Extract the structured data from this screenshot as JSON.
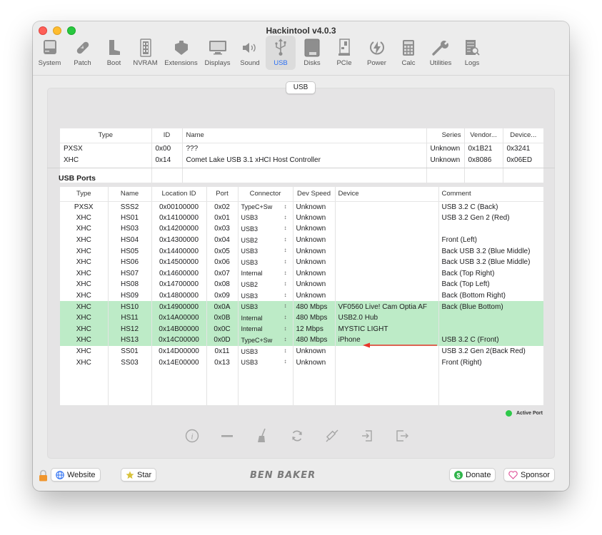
{
  "window": {
    "title": "Hackintool v4.0.3"
  },
  "toolbar": {
    "items": [
      {
        "label": "System",
        "icon": "system-icon"
      },
      {
        "label": "Patch",
        "icon": "bandage-icon"
      },
      {
        "label": "Boot",
        "icon": "boot-icon"
      },
      {
        "label": "NVRAM",
        "icon": "nvram-icon"
      },
      {
        "label": "Extensions",
        "icon": "extensions-icon"
      },
      {
        "label": "Displays",
        "icon": "display-icon"
      },
      {
        "label": "Sound",
        "icon": "speaker-icon"
      },
      {
        "label": "USB",
        "icon": "usb-icon",
        "active": true
      },
      {
        "label": "Disks",
        "icon": "disk-icon"
      },
      {
        "label": "PCIe",
        "icon": "pcie-icon"
      },
      {
        "label": "Power",
        "icon": "power-icon"
      },
      {
        "label": "Calc",
        "icon": "calculator-icon"
      },
      {
        "label": "Utilities",
        "icon": "wrench-icon"
      },
      {
        "label": "Logs",
        "icon": "logs-icon"
      }
    ]
  },
  "segment": {
    "label": "USB"
  },
  "controllers": {
    "headers": [
      "Type",
      "ID",
      "Name",
      "Series",
      "Vendor...",
      "Device..."
    ],
    "rows": [
      [
        "PXSX",
        "0x00",
        "???",
        "Unknown",
        "0x1B21",
        "0x3241"
      ],
      [
        "XHC",
        "0x14",
        "Comet Lake USB 3.1 xHCI Host Controller",
        "Unknown",
        "0x8086",
        "0x06ED"
      ]
    ]
  },
  "ports": {
    "section_label": "USB Ports",
    "headers": [
      "Type",
      "Name",
      "Location ID",
      "Port",
      "Connector",
      "Dev Speed",
      "Device",
      "Comment"
    ],
    "rows": [
      {
        "type": "PXSX",
        "name": "SSS2",
        "location": "0x00100000",
        "port": "0x02",
        "connector": "TypeC+Sw",
        "speed": "Unknown",
        "device": "",
        "comment": "USB 3.2 C (Back)",
        "active": false
      },
      {
        "type": "XHC",
        "name": "HS01",
        "location": "0x14100000",
        "port": "0x01",
        "connector": "USB3",
        "speed": "Unknown",
        "device": "",
        "comment": "USB 3.2 Gen 2 (Red)",
        "active": false
      },
      {
        "type": "XHC",
        "name": "HS03",
        "location": "0x14200000",
        "port": "0x03",
        "connector": "USB3",
        "speed": "Unknown",
        "device": "",
        "comment": "",
        "active": false
      },
      {
        "type": "XHC",
        "name": "HS04",
        "location": "0x14300000",
        "port": "0x04",
        "connector": "USB2",
        "speed": "Unknown",
        "device": "",
        "comment": "Front (Left)",
        "active": false
      },
      {
        "type": "XHC",
        "name": "HS05",
        "location": "0x14400000",
        "port": "0x05",
        "connector": "USB3",
        "speed": "Unknown",
        "device": "",
        "comment": "Back USB 3.2 (Blue Middle)",
        "active": false
      },
      {
        "type": "XHC",
        "name": "HS06",
        "location": "0x14500000",
        "port": "0x06",
        "connector": "USB3",
        "speed": "Unknown",
        "device": "",
        "comment": "Back USB 3.2 (Blue Middle)",
        "active": false
      },
      {
        "type": "XHC",
        "name": "HS07",
        "location": "0x14600000",
        "port": "0x07",
        "connector": "Internal",
        "speed": "Unknown",
        "device": "",
        "comment": "Back (Top Right)",
        "active": false
      },
      {
        "type": "XHC",
        "name": "HS08",
        "location": "0x14700000",
        "port": "0x08",
        "connector": "USB2",
        "speed": "Unknown",
        "device": "",
        "comment": "Back (Top Left)",
        "active": false
      },
      {
        "type": "XHC",
        "name": "HS09",
        "location": "0x14800000",
        "port": "0x09",
        "connector": "USB3",
        "speed": "Unknown",
        "device": "",
        "comment": "Back (Bottom Right)",
        "active": false
      },
      {
        "type": "XHC",
        "name": "HS10",
        "location": "0x14900000",
        "port": "0x0A",
        "connector": "USB3",
        "speed": "480 Mbps",
        "device": "VF0560 Live! Cam Optia AF",
        "comment": "Back (Blue Bottom)",
        "active": true
      },
      {
        "type": "XHC",
        "name": "HS11",
        "location": "0x14A00000",
        "port": "0x0B",
        "connector": "Internal",
        "speed": "480 Mbps",
        "device": "USB2.0 Hub",
        "comment": "",
        "active": true
      },
      {
        "type": "XHC",
        "name": "HS12",
        "location": "0x14B00000",
        "port": "0x0C",
        "connector": "Internal",
        "speed": "12 Mbps",
        "device": "MYSTIC LIGHT",
        "comment": "",
        "active": true
      },
      {
        "type": "XHC",
        "name": "HS13",
        "location": "0x14C00000",
        "port": "0x0D",
        "connector": "TypeC+Sw",
        "speed": "480 Mbps",
        "device": "iPhone",
        "comment": "USB 3.2 C (Front)",
        "active": true
      },
      {
        "type": "XHC",
        "name": "SS01",
        "location": "0x14D00000",
        "port": "0x11",
        "connector": "USB3",
        "speed": "Unknown",
        "device": "",
        "comment": "USB 3.2 Gen 2(Back Red)",
        "active": false
      },
      {
        "type": "XHC",
        "name": "SS03",
        "location": "0x14E00000",
        "port": "0x13",
        "connector": "USB3",
        "speed": "Unknown",
        "device": "",
        "comment": "Front (Right)",
        "active": false
      }
    ]
  },
  "legend": {
    "label": "Active Port",
    "color": "#2ec94a"
  },
  "active_row_color": "#bdebc7",
  "annotation_arrow_color": "#e8362b",
  "footer": {
    "website_label": "Website",
    "star_label": "Star",
    "brand": "BEN BAKER",
    "donate_label": "Donate",
    "sponsor_label": "Sponsor"
  }
}
